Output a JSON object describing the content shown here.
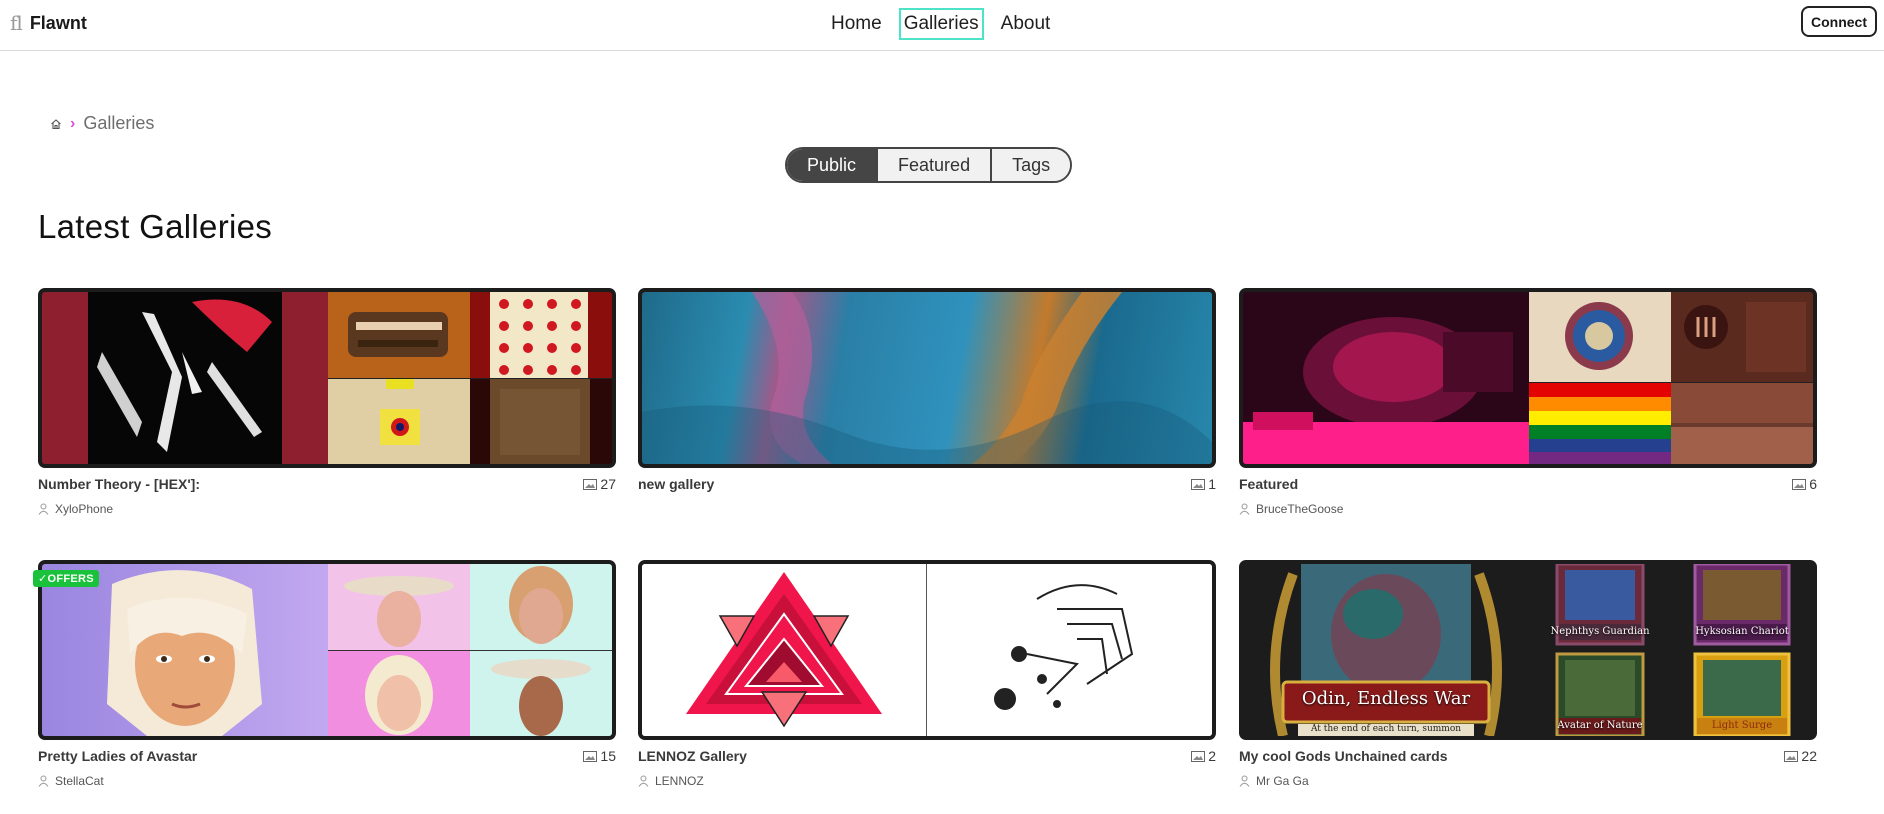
{
  "brand": {
    "mark": "fl",
    "name": "Flawnt"
  },
  "nav": {
    "items": [
      {
        "label": "Home",
        "active": false
      },
      {
        "label": "Galleries",
        "active": true
      },
      {
        "label": "About",
        "active": false
      }
    ],
    "connect_label": "Connect"
  },
  "breadcrumb": {
    "current": "Galleries"
  },
  "tabs": [
    {
      "label": "Public",
      "active": true
    },
    {
      "label": "Featured",
      "active": false
    },
    {
      "label": "Tags",
      "active": false
    }
  ],
  "section_title": "Latest Galleries",
  "galleries": [
    {
      "title": "Number Theory - [HEX']:",
      "count": "27",
      "owner": "XyloPhone"
    },
    {
      "title": "new gallery",
      "count": "1",
      "owner": ""
    },
    {
      "title": "Featured",
      "count": "6",
      "owner": "BruceTheGoose"
    },
    {
      "title": "Pretty Ladies of Avastar",
      "count": "15",
      "owner": "StellaCat",
      "badge": "✓OFFERS"
    },
    {
      "title": "LENNOZ Gallery",
      "count": "2",
      "owner": "LENNOZ"
    },
    {
      "title": "My cool Gods Unchained cards",
      "count": "22",
      "owner": "Mr Ga Ga",
      "card_texts": [
        "Odin, Endless War",
        "At the end of each turn, summon",
        "Nephthys Guardian",
        "Hyksosian Chariot",
        "Avatar of Nature",
        "Light Surge"
      ]
    }
  ],
  "colors": {
    "accent": "#4de3c6",
    "badge": "#19c23a",
    "breadcrumb_sep": "#d64fd0"
  }
}
